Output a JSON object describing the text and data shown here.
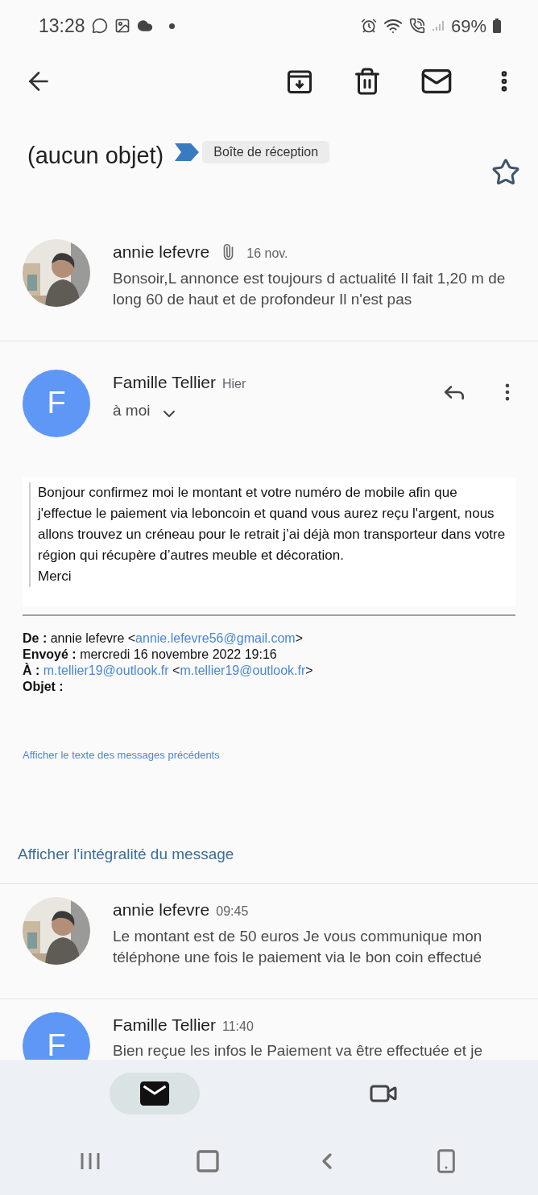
{
  "status_bar": {
    "time": "13:28",
    "battery": "69%"
  },
  "subject": {
    "title": "(aucun objet)",
    "label": "Boîte de réception",
    "starred": false
  },
  "messages": [
    {
      "kind": "collapsed",
      "sender": "annie lefevre",
      "date": "16 nov.",
      "attachment": true,
      "snippet": "Bonsoir,L annonce est toujours d actualité Il fait 1,20 m de long 60 de haut et de profondeur Il n'est pas"
    },
    {
      "kind": "expanded",
      "sender": "Famille Tellier",
      "date": "Hier",
      "avatar": {
        "kind": "letter",
        "letter": "F"
      },
      "recipient": "à moi",
      "quote": [
        "Bonjour confirmez moi le montant et votre numéro de mobile  afin  que j'effectue le paiement via leboncoin et quand vous aurez reçu l'argent, nous allons trouvez un créneau pour le retrait j’ai déjà mon transporteur dans votre région qui récupère d’autres meuble et décoration.",
        "Merci"
      ],
      "headers": [
        {
          "label": "De :",
          "parts": [
            {
              "kind": "text",
              "text": "annie lefevre <"
            },
            {
              "kind": "link",
              "text": "annie.lefevre56@gmail.com"
            },
            {
              "kind": "text",
              "text": ">"
            }
          ]
        },
        {
          "label": "Envoyé :",
          "parts": [
            {
              "kind": "text",
              "text": "mercredi 16 novembre 2022 19:16"
            }
          ]
        },
        {
          "label": "À :",
          "parts": [
            {
              "kind": "link",
              "text": "m.tellier19@outlook.fr"
            },
            {
              "kind": "text",
              "text": " <"
            },
            {
              "kind": "link",
              "text": "m.tellier19@outlook.fr"
            },
            {
              "kind": "text",
              "text": ">"
            }
          ]
        },
        {
          "label": "Objet :"
        }
      ],
      "show_previous": "Afficher le texte des messages précédents",
      "show_full": "Afficher l'intégralité du message"
    },
    {
      "kind": "collapsed",
      "sender": "annie lefevre",
      "date": "09:45",
      "attachment": false,
      "snippet": "Le montant est de 50 euros Je vous communique mon téléphone une fois le paiement via le bon coin effectué"
    },
    {
      "kind": "collapsed",
      "sender": "Famille Tellier",
      "date": "11:40",
      "attachment": false,
      "avatar": {
        "kind": "letter",
        "letter": "F"
      },
      "snippet": "Bien reçue les infos le Paiement va être effectuée et je"
    }
  ],
  "bottom_tabs": [
    {
      "kind": "mail",
      "selected": true
    },
    {
      "kind": "video",
      "selected": false
    }
  ]
}
